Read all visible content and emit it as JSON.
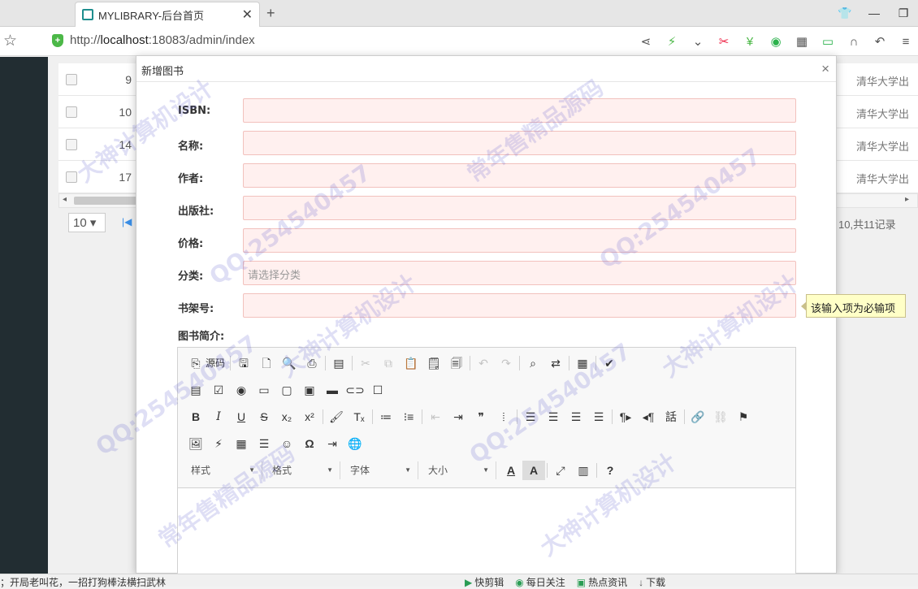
{
  "browser": {
    "tab_title": "MYLIBRARY-后台首页",
    "tab_close": "✕",
    "new_tab": "+",
    "url_prefix": "http://",
    "url_host": "localhost",
    "url_rest": ":18083/admin/index"
  },
  "table": {
    "rows": [
      {
        "num": "9",
        "publisher": "清华大学出"
      },
      {
        "num": "10",
        "publisher": "清华大学出"
      },
      {
        "num": "14",
        "publisher": "清华大学出"
      },
      {
        "num": "17",
        "publisher": "清华大学出"
      }
    ],
    "page_size": "10 ▾",
    "page_info": "10,共11记录"
  },
  "dialog": {
    "title": "新增图书",
    "close": "×",
    "fields": [
      {
        "label": "ISBN:",
        "value": "",
        "placeholder": ""
      },
      {
        "label": "名称:",
        "value": "",
        "placeholder": ""
      },
      {
        "label": "作者:",
        "value": "",
        "placeholder": ""
      },
      {
        "label": "出版社:",
        "value": "",
        "placeholder": ""
      },
      {
        "label": "价格:",
        "value": "",
        "placeholder": ""
      },
      {
        "label": "分类:",
        "value": "",
        "placeholder": "请选择分类"
      },
      {
        "label": "书架号:",
        "value": "",
        "placeholder": ""
      }
    ],
    "tooltip": "该输入项为必输项",
    "intro_label": "图书简介:",
    "editor": {
      "source_label": "源码",
      "combos": [
        "样式",
        "格式",
        "字体",
        "大小"
      ]
    }
  },
  "statusbar": {
    "left_text": "；开局老叫花，一招打狗棒法横扫武林",
    "items": [
      "快剪辑",
      "每日关注",
      "热点资讯",
      "下载"
    ]
  },
  "watermarks": [
    "QQ:254540457",
    "大神计算机设计",
    "常年售精品源码"
  ]
}
